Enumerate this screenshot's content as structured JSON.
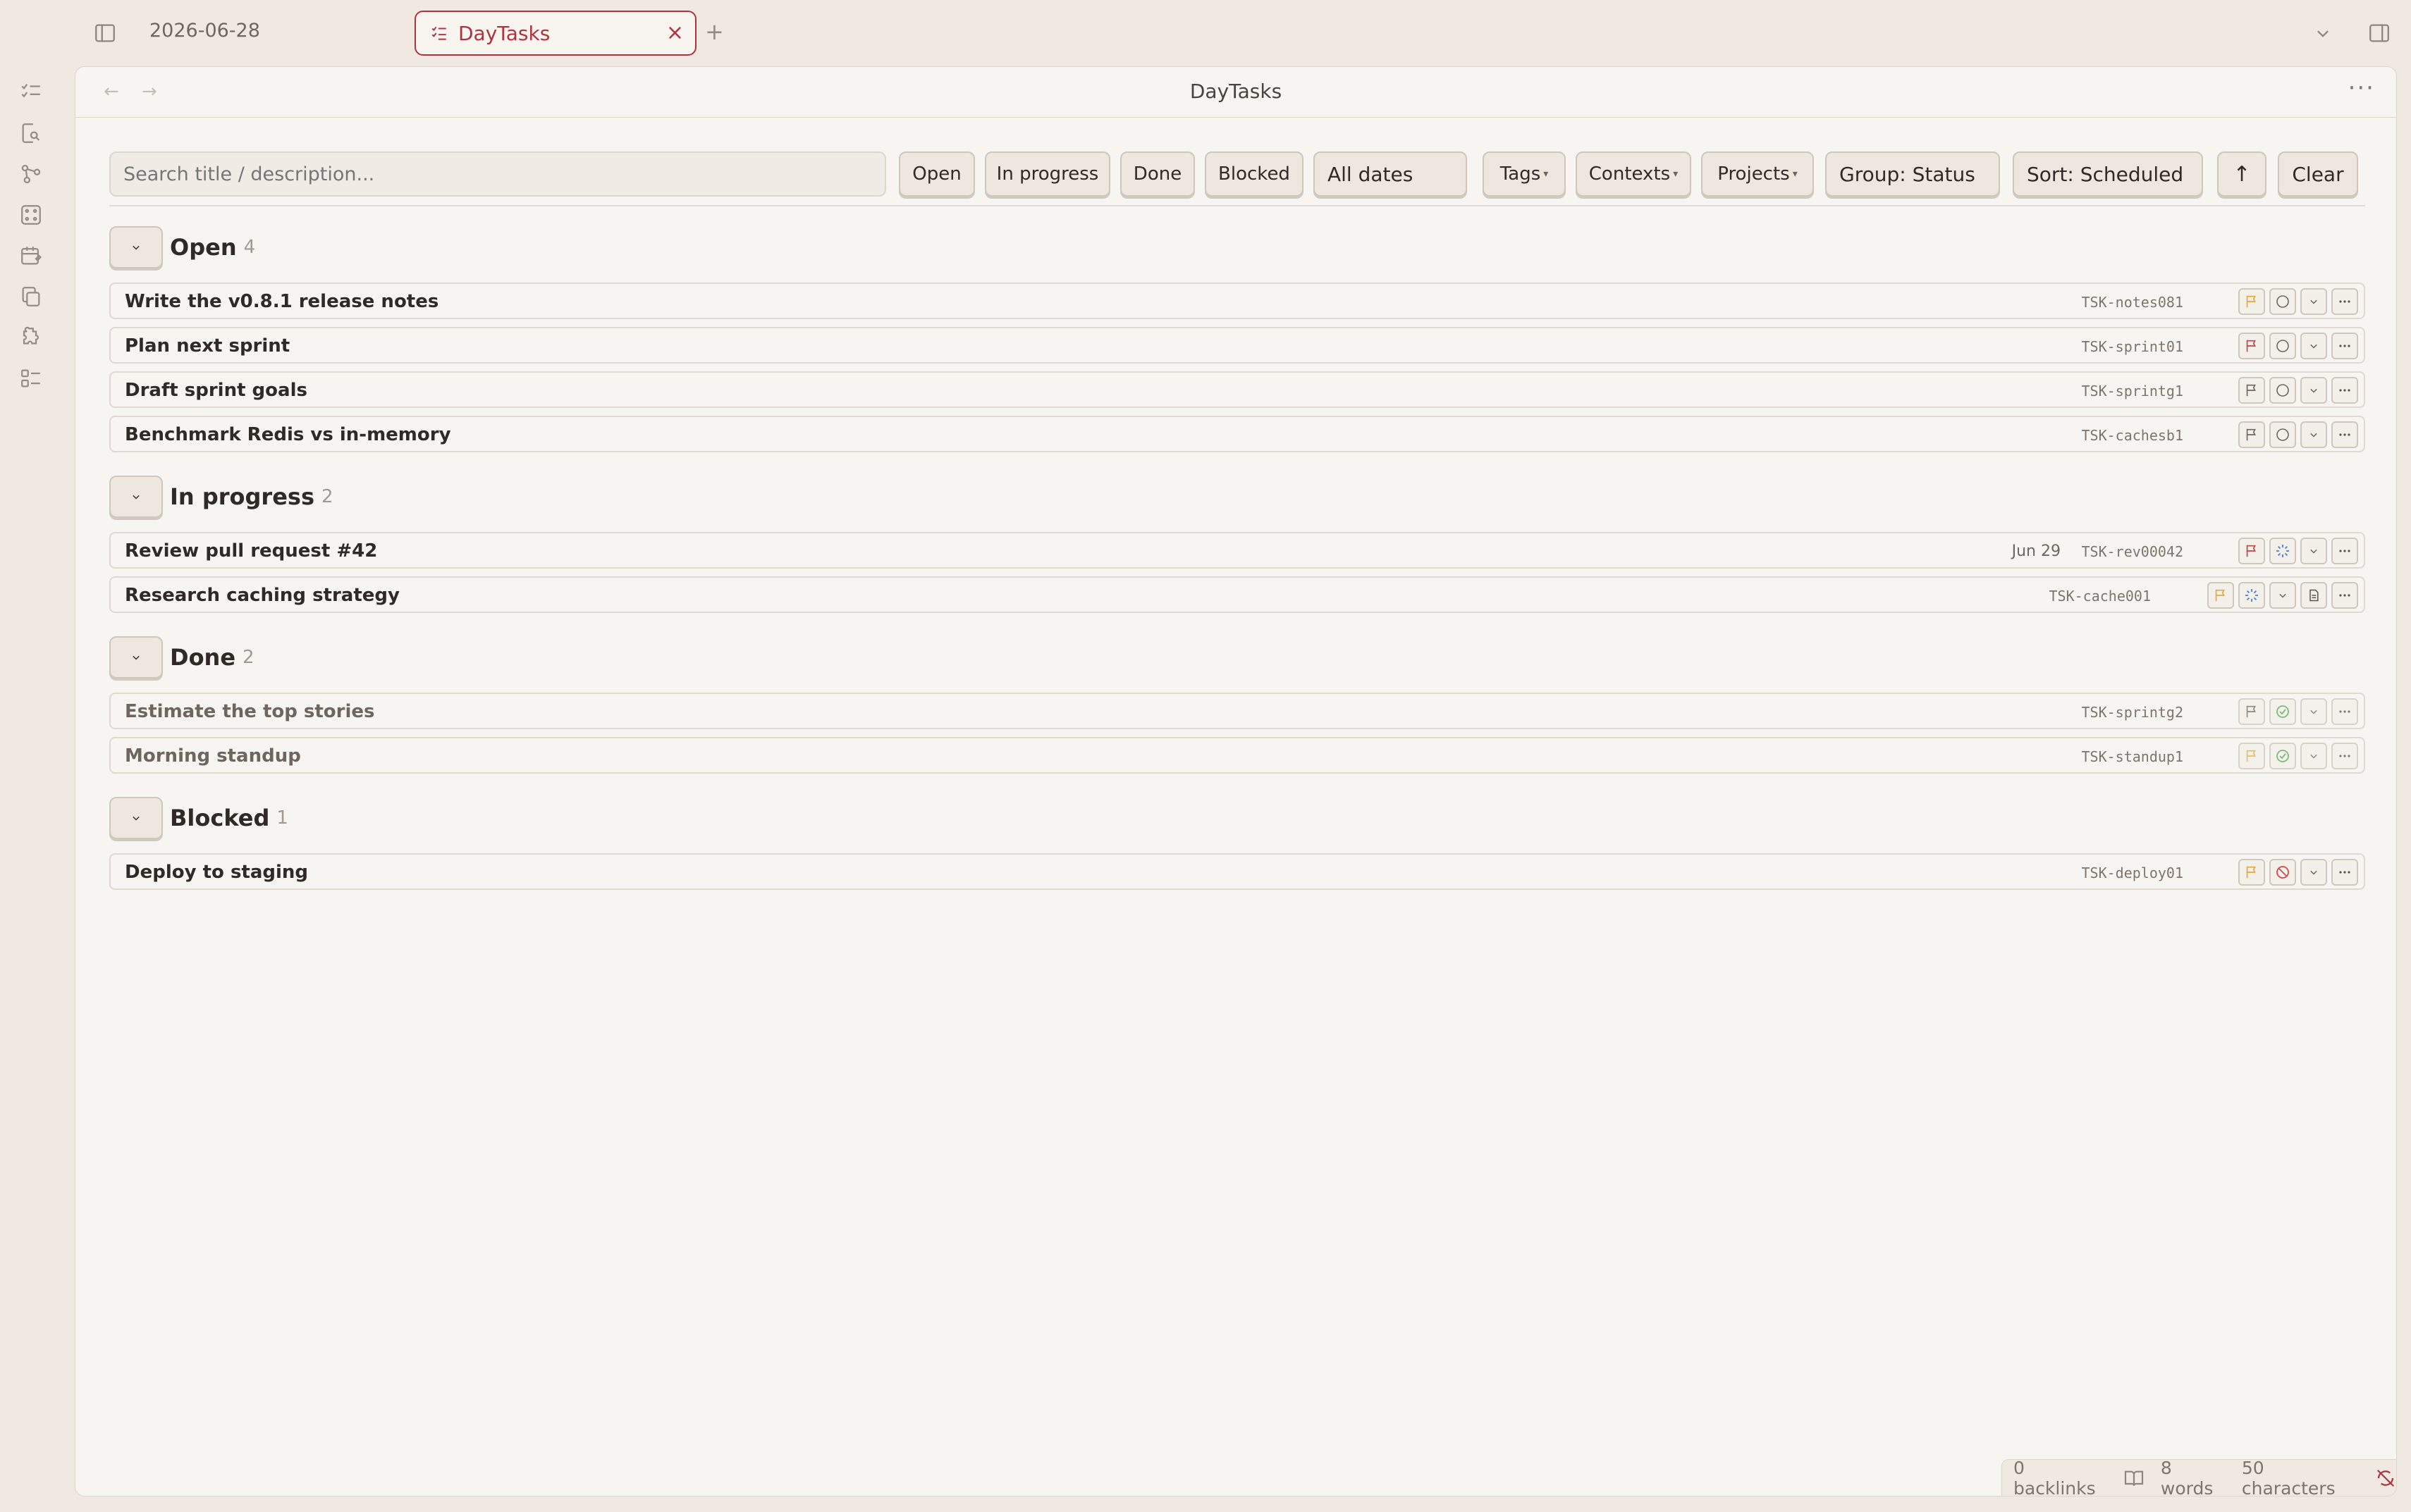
{
  "tabs": {
    "inactive_label": "2026-06-28",
    "active_label": "DayTasks",
    "close_glyph": "×",
    "new_glyph": "+"
  },
  "view": {
    "title": "DayTasks",
    "back_glyph": "←",
    "forward_glyph": "→",
    "more_glyph": "···"
  },
  "toolbar": {
    "search_placeholder": "Search title / description...",
    "filter_open": "Open",
    "filter_in_progress": "In progress",
    "filter_done": "Done",
    "filter_blocked": "Blocked",
    "dates_select": "All dates",
    "tags": "Tags",
    "contexts": "Contexts",
    "projects": "Projects",
    "group_select": "Group: Status",
    "sort_select": "Sort: Scheduled",
    "sort_dir_glyph": "↑",
    "clear": "Clear"
  },
  "groups": [
    {
      "title": "Open",
      "count": "4",
      "tasks": [
        {
          "title": "Write the v0.8.1 release notes",
          "id": "TSK-notes081",
          "due": "",
          "priority": "#e3a83a",
          "status": "open"
        },
        {
          "title": "Plan next sprint",
          "id": "TSK-sprint01",
          "due": "",
          "priority": "#c0424b",
          "status": "open"
        },
        {
          "title": "Draft sprint goals",
          "id": "TSK-sprintg1",
          "due": "",
          "priority": "#6f675e",
          "status": "open"
        },
        {
          "title": "Benchmark Redis vs in-memory",
          "id": "TSK-cachesb1",
          "due": "",
          "priority": "#6f675e",
          "status": "open"
        }
      ]
    },
    {
      "title": "In progress",
      "count": "2",
      "tasks": [
        {
          "title": "Review pull request #42",
          "id": "TSK-rev00042",
          "due": "Jun 29",
          "priority": "#c0424b",
          "status": "in-progress"
        },
        {
          "title": "Research caching strategy",
          "id": "TSK-cache001",
          "due": "",
          "priority": "#e3a83a",
          "status": "in-progress"
        }
      ]
    },
    {
      "title": "Done",
      "count": "2",
      "tasks": [
        {
          "title": "Estimate the top stories",
          "id": "TSK-sprintg2",
          "due": "",
          "priority": "#6f675e",
          "status": "done"
        },
        {
          "title": "Morning standup",
          "id": "TSK-standup1",
          "due": "",
          "priority": "#e3a83a",
          "status": "done"
        }
      ]
    },
    {
      "title": "Blocked",
      "count": "1",
      "tasks": [
        {
          "title": "Deploy to staging",
          "id": "TSK-deploy01",
          "due": "",
          "priority": "#e3a83a",
          "status": "blocked"
        }
      ]
    }
  ],
  "statusbar": {
    "backlinks": "0 backlinks",
    "words": "8 words",
    "characters": "50 characters"
  },
  "colors": {
    "accent": "#b0323d",
    "in_progress": "#4f7fd0",
    "done": "#4caf50",
    "blocked": "#d24b4b"
  }
}
